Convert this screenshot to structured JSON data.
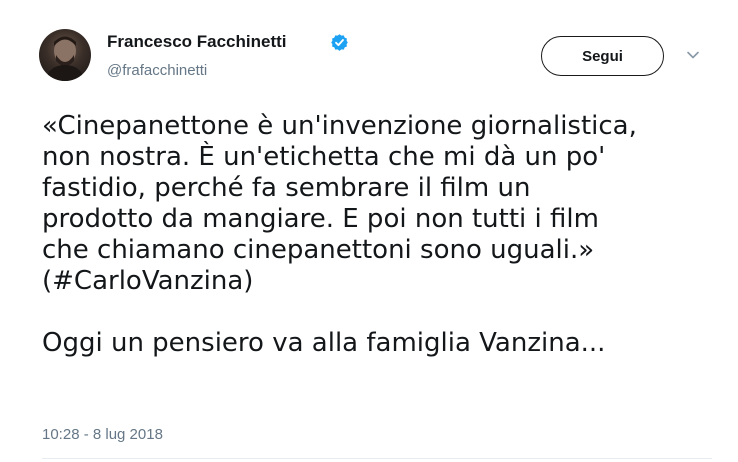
{
  "author": {
    "name": "Francesco Facchinetti",
    "handle": "@frafacchinetti",
    "verified": true
  },
  "follow_button": {
    "label": "Segui"
  },
  "tweet": {
    "lines": [
      "«Cinepanettone è un'invenzione giornalistica,",
      "non nostra. È un'etichetta che mi dà un po'",
      "fastidio, perché fa sembrare il film un",
      "prodotto da mangiare. E poi non tutti i film",
      "che chiamano cinepanettoni sono uguali.»",
      "(#CarloVanzina)"
    ],
    "closing": "Oggi un pensiero va alla famiglia Vanzina...",
    "timestamp": "10:28 - 8 lug 2018"
  },
  "icons": {
    "verified": "verified-badge-icon",
    "caret": "chevron-down-icon"
  },
  "colors": {
    "verified_blue": "#1da1f2",
    "text": "#14171a",
    "secondary_text": "#657786",
    "divider": "#e6ecf0"
  }
}
